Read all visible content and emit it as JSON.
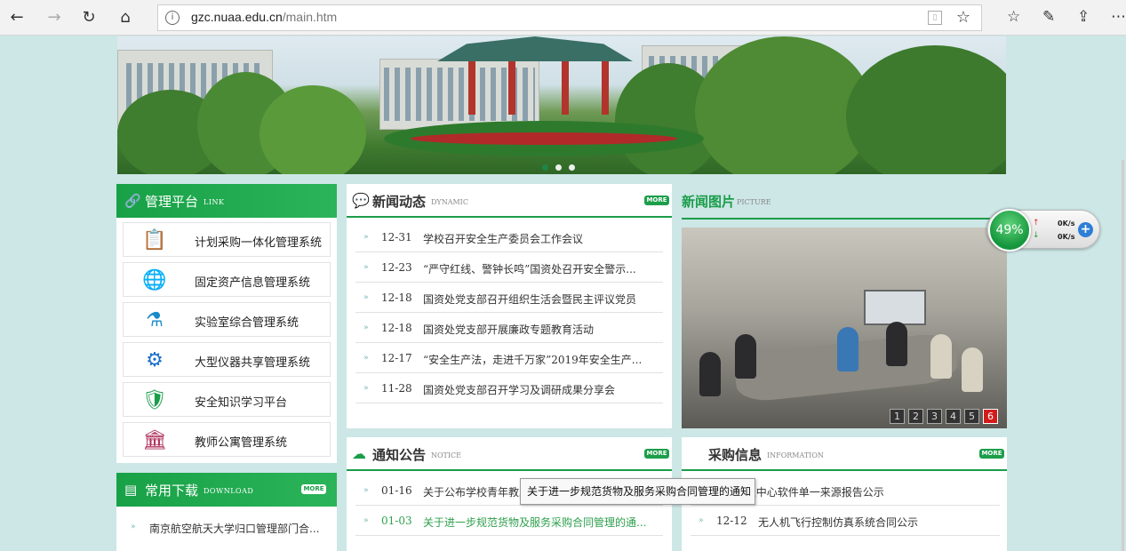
{
  "browser": {
    "url_host": "gzc.nuaa.edu.cn",
    "url_path": "/main.htm"
  },
  "banner": {
    "slides": 3,
    "active_slide": 1
  },
  "management": {
    "title": "管理平台",
    "subtitle": "LINK",
    "items": [
      {
        "label": "计划采购一体化管理系统",
        "icon": "clipboard-icon"
      },
      {
        "label": "固定资产信息管理系统",
        "icon": "globe-refresh-icon"
      },
      {
        "label": "实验室综合管理系统",
        "icon": "flask-icon"
      },
      {
        "label": "大型仪器共享管理系统",
        "icon": "gear-instrument-icon"
      },
      {
        "label": "安全知识学习平台",
        "icon": "shield-check-icon"
      },
      {
        "label": "教师公寓管理系统",
        "icon": "building-icon"
      }
    ]
  },
  "downloads": {
    "title": "常用下载",
    "subtitle": "DOWNLOAD",
    "more": "MORE",
    "items": [
      {
        "text": "南京航空航天大学归口管理部门合..."
      }
    ]
  },
  "news": {
    "title": "新闻动态",
    "subtitle": "DYNAMIC",
    "more": "MORE",
    "items": [
      {
        "date": "12-31",
        "text": "学校召开安全生产委员会工作会议"
      },
      {
        "date": "12-23",
        "text": "“严守红线、警钟长鸣”国资处召开安全警示..."
      },
      {
        "date": "12-18",
        "text": "国资处党支部召开组织生活会暨民主评议党员"
      },
      {
        "date": "12-18",
        "text": "国资处党支部开展廉政专题教育活动"
      },
      {
        "date": "12-17",
        "text": "“安全生产法，走进千万家”2019年安全生产..."
      },
      {
        "date": "11-28",
        "text": "国资处党支部召开学习及调研成果分享会"
      }
    ]
  },
  "pictures": {
    "title": "新闻图片",
    "subtitle": "PICTURE",
    "pages": [
      "1",
      "2",
      "3",
      "4",
      "5",
      "6"
    ],
    "active_page": "6"
  },
  "notices": {
    "title": "通知公告",
    "subtitle": "NOTICE",
    "more": "MORE",
    "items": [
      {
        "date": "01-16",
        "text": "关于公布学校青年教工"
      },
      {
        "date": "01-03",
        "text": "关于进一步规范货物及服务采购合同管理的通..."
      }
    ]
  },
  "purchase": {
    "title": "采购信息",
    "subtitle": "INFORMATION",
    "more": "MORE",
    "items": [
      {
        "text": "recitech虚拟中心软件单一来源报告公示"
      },
      {
        "date": "12-12",
        "text": "无人机飞行控制仿真系统合同公示"
      }
    ]
  },
  "net_widget": {
    "percent": "49%",
    "up": "0K/s",
    "down": "0K/s"
  },
  "tooltip": "关于进一步规范货物及服务采购合同管理的通知"
}
